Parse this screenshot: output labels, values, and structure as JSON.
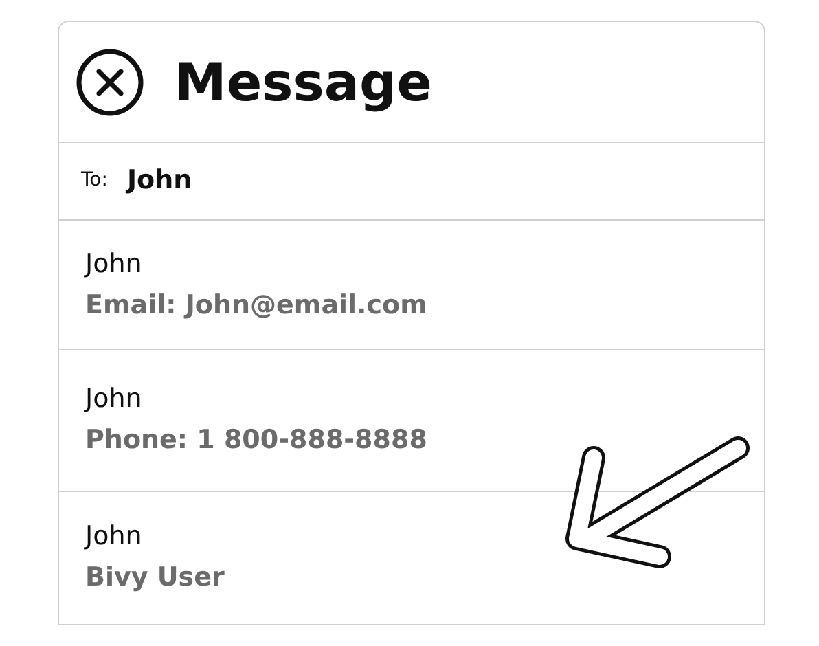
{
  "header": {
    "title": "Message"
  },
  "recipient": {
    "label": "To:",
    "value": "John"
  },
  "contacts": [
    {
      "name": "John",
      "detail": "Email: John@email.com"
    },
    {
      "name": "John",
      "detail": "Phone: 1 800-888-8888"
    },
    {
      "name": "John",
      "detail": "Bivy User"
    }
  ]
}
